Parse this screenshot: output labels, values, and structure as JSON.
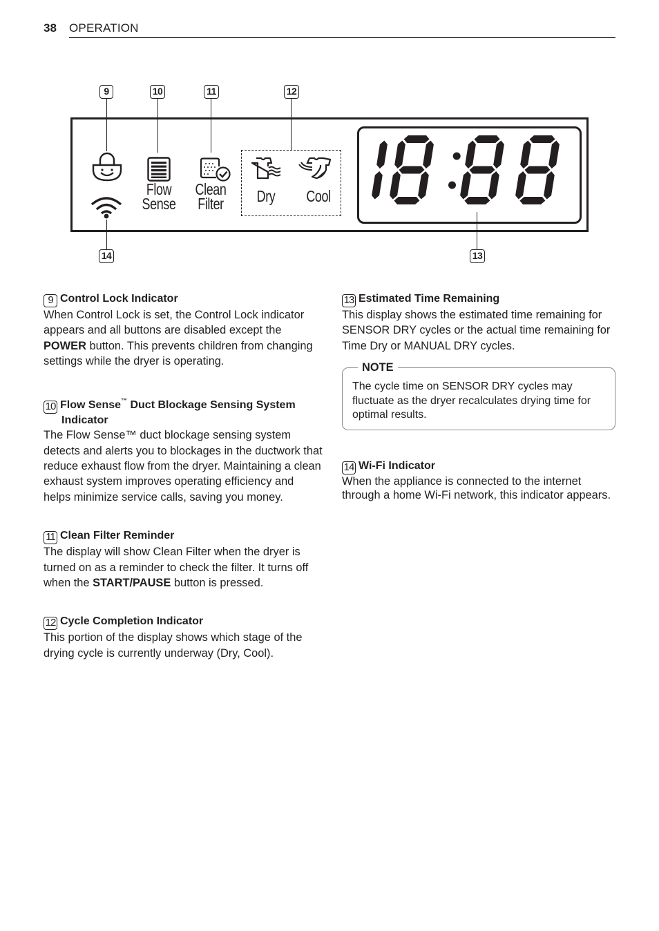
{
  "header": {
    "page_number": "38",
    "section_title": "OPERATION"
  },
  "diagram": {
    "callouts": {
      "c9": "9",
      "c10": "10",
      "c11": "11",
      "c12": "12",
      "c13": "13",
      "c14": "14"
    },
    "icons": {
      "control_lock": "lock-smiley-icon",
      "wifi": "wifi-icon",
      "flow_sense": "flow-sense-icon",
      "clean_filter": "clean-filter-icon",
      "dry": "shirt-dry-icon",
      "cool": "shirt-cool-icon"
    },
    "labels": {
      "flow_line1": "Flow",
      "flow_line2": "Sense",
      "clean_line1": "Clean",
      "clean_line2": "Filter",
      "dry": "Dry",
      "cool": "Cool"
    },
    "display_readout": "18:88"
  },
  "left_column": [
    {
      "num": "9",
      "title": "Control Lock Indicator",
      "body_pre": "When Control Lock is set, the Control Lock indicator appears and all buttons are disabled except the ",
      "body_bold": "POWER",
      "body_post": " button. This prevents children from changing settings while the dryer is operating."
    },
    {
      "num": "10",
      "title_a": "Flow Sense",
      "title_tm": "™",
      "title_b": " Duct Blockage Sensing System",
      "title_line2": "Indicator",
      "body": "The Flow Sense™ duct blockage sensing system detects and alerts you to blockages in the ductwork that reduce exhaust flow from the dryer. Maintaining a clean exhaust system improves operating efficiency and helps minimize service calls, saving you money."
    },
    {
      "num": "11",
      "title": "Clean Filter Reminder",
      "body_pre": "The display will show Clean Filter when the dryer is turned on as a reminder to check the filter. It turns off when the ",
      "body_bold": "START/PAUSE",
      "body_post": " button is pressed."
    },
    {
      "num": "12",
      "title": "Cycle Completion Indicator",
      "body": "This portion of the display shows which stage of the drying cycle is currently underway (Dry, Cool)."
    }
  ],
  "right_column": [
    {
      "num": "13",
      "title": "Estimated Time Remaining",
      "body": "This display shows the estimated time remaining for SENSOR DRY cycles or the actual time remaining for Time Dry or MANUAL DRY cycles.",
      "note": {
        "label": "NOTE",
        "text": "The cycle time on SENSOR DRY cycles may fluctuate as the dryer recalculates drying time for optimal results."
      }
    },
    {
      "num": "14",
      "title": "Wi-Fi Indicator",
      "body": "When the appliance is connected to the internet through a home Wi-Fi network, this indicator appears."
    }
  ]
}
